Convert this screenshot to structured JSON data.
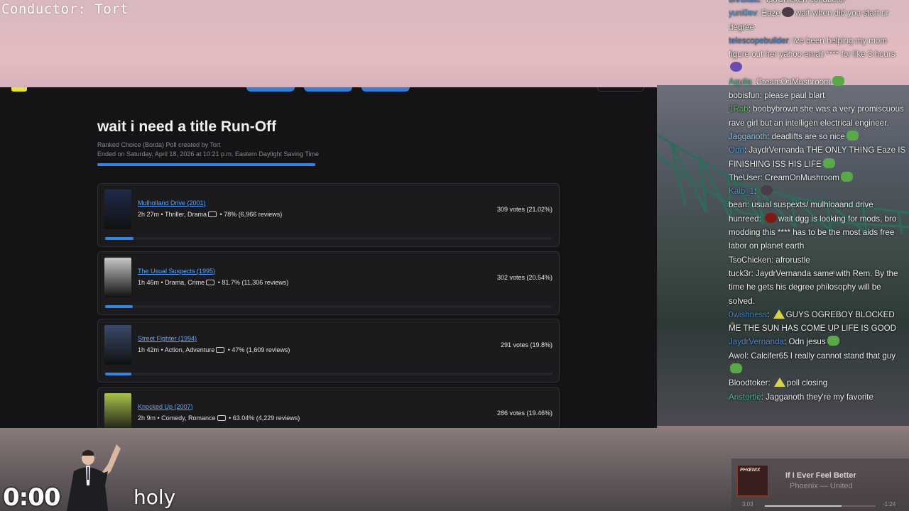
{
  "overlay": {
    "conductor": "Conductor: Tort",
    "timer": "0:00",
    "caption": "holy"
  },
  "poll": {
    "title": "wait i need a title Run-Off",
    "subtitle": "Ranked Choice (Borda) Poll created by Tort",
    "ended": "Ended on Saturday, April 18, 2026 at 10:21 p.m. Eastern Daylight Saving Time",
    "progress": 0.49,
    "options": [
      {
        "title": "Mulholland Drive (2001)",
        "runtime": "2h 27m",
        "genres": "Thriller, Drama",
        "rating": "78% (6,966 reviews)",
        "votes": "309 votes (21.02%)",
        "percent": 21.02,
        "poster_color": "#1e2a4a"
      },
      {
        "title": "The Usual Suspects (1995)",
        "runtime": "1h 46m",
        "genres": "Drama, Crime",
        "rating": "81.7% (11,306 reviews)",
        "votes": "302 votes (20.54%)",
        "percent": 20.54,
        "poster_color": "#c8c8c8"
      },
      {
        "title": "Street Fighter (1994)",
        "runtime": "1h 42m",
        "genres": "Action, Adventure",
        "rating": "47% (1,609 reviews)",
        "votes": "291 votes (19.8%)",
        "percent": 19.8,
        "poster_color": "#3a4a6a"
      },
      {
        "title": "Knocked Up (2007)",
        "runtime": "2h 9m",
        "genres": "Comedy, Romance",
        "rating": "63.04% (4,229 reviews)",
        "votes": "286 votes (19.46%)",
        "percent": 19.46,
        "poster_color": "#a8c24a"
      }
    ]
  },
  "chat": [
    {
      "user": "unruxatc",
      "color": "#5a8fd8",
      "pre": "",
      "text": "TsoChicken conductor"
    },
    {
      "user": "yuni0ev",
      "color": "#5aa8e0",
      "pre": "",
      "text": "Eaze",
      "emote": "em-dark",
      "after": "wait when did you start ur degree"
    },
    {
      "user": "telescopebuilder",
      "color": "#4a8ad0",
      "pre": "",
      "text": "ive been helping my mom figure out her yahoo email **** for like 3 hours",
      "emote_end": "em-purple"
    },
    {
      "user": "Aquila",
      "color": "#5ac0a0",
      "pre": "",
      "text": "CreamOnMushroom",
      "emote_end": "em-pepe"
    },
    {
      "user": "bobisfun",
      "color": "#f0f0f0",
      "pre": "",
      "text": "please paul blart"
    },
    {
      "user": "1Rab",
      "color": "#6ac06a",
      "pre": "",
      "text": "boobybrown she was a very promiscuous rave girl but an intelligen electrical engineer."
    },
    {
      "user": "Jagganoth",
      "color": "#9ad0f0",
      "pre": "",
      "text": "deadlifts are so nice",
      "emote_end": "em-pepe"
    },
    {
      "user": "Odn",
      "color": "#5aa8e0",
      "pre": "",
      "text": "JaydrVernanda THE ONLY THING Eaze IS FINISHING ISS HIS LIFE",
      "emote_end": "em-pepe"
    },
    {
      "user": "TheUser",
      "color": "#f0f0f0",
      "pre": "",
      "text": "CreamOnMushroom",
      "emote_end": "em-pepe"
    },
    {
      "user": "Kaib_1",
      "color": "#5a9ad8",
      "pre": "",
      "text": "",
      "emote_end": "em-dark"
    },
    {
      "user": "bean",
      "color": "#f0f0f0",
      "pre": "",
      "text": "usual suspexts/ mulhloaand drive"
    },
    {
      "user": "hunreed",
      "color": "#f0f0f0",
      "pre": "",
      "text": "",
      "emote": "em-red",
      "after": "wait dgg is looking for mods, bro modding this **** has to be the most aids free labor on planet earth"
    },
    {
      "user": "TsoChicken",
      "color": "#f0f0f0",
      "pre": "",
      "text": "afrorustle"
    },
    {
      "user": "tuck3r",
      "color": "#f0f0f0",
      "pre": "",
      "text": "JaydrVernanda same with Rem. By the time he gets his degree philosophy will be solved."
    },
    {
      "user": "0wishness",
      "color": "#4a8ad0",
      "pre": "",
      "text": "",
      "emote": "em-tri",
      "after": "GUYS OGREBOY BLOCKED ME THE SUN HAS COME UP LIFE IS GOOD"
    },
    {
      "user": "JaydrVernanda",
      "color": "#5a8fd8",
      "pre": "",
      "text": "Odn jesus",
      "emote_end": "em-pepe"
    },
    {
      "user": "Awol",
      "color": "#f0f0f0",
      "pre": "",
      "text": "Calcifer65 I really cannot stand that guy",
      "emote_end": "em-pepe"
    },
    {
      "user": "Bloodtoker",
      "color": "#f0f0f0",
      "pre": "",
      "text": "",
      "emote": "em-tri",
      "after": "poll closing"
    },
    {
      "user": "Aristortle",
      "color": "#5ac0a0",
      "pre": "",
      "text": "Jagganoth they're my favorite"
    }
  ],
  "music": {
    "song": "If I Ever Feel Better",
    "artist": "Phoenix — United",
    "cover_text": "PHŒNIX",
    "elapsed": "3:03",
    "remaining": "-1:24",
    "progress": 0.69
  }
}
